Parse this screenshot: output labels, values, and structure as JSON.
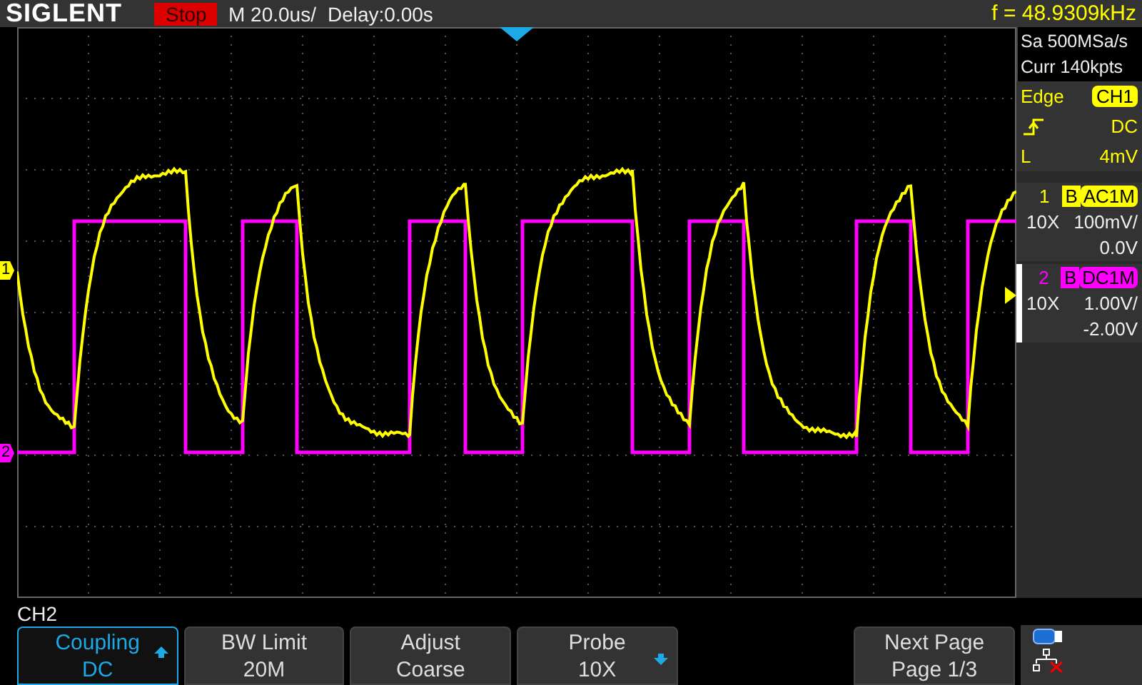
{
  "top_bar": {
    "logo": "SIGLENT",
    "run_state": "Stop",
    "timebase": "M 20.0us/",
    "delay": "Delay:0.00s",
    "frequency": "f = 48.9309kHz"
  },
  "acquisition": {
    "sample_rate": "Sa 500MSa/s",
    "memory": "Curr 140kpts"
  },
  "trigger": {
    "type": "Edge",
    "source": "CH1",
    "coupling": "DC",
    "mode": "L",
    "level": "4mV"
  },
  "channels": [
    {
      "marker": "1",
      "number": "1",
      "bandwidth": "B",
      "coupling": "AC1M",
      "probe": "10X",
      "scale": "100mV/",
      "offset": "0.0V",
      "color": "#ffff00",
      "selected": false
    },
    {
      "marker": "2",
      "number": "2",
      "bandwidth": "B",
      "coupling": "DC1M",
      "probe": "10X",
      "scale": "1.00V/",
      "offset": "-2.00V",
      "color": "#ff00ff",
      "selected": true
    }
  ],
  "menu_title": "CH2",
  "softkeys": [
    {
      "label": "Coupling",
      "value": "DC",
      "selected": true,
      "kind": "up"
    },
    {
      "label": "BW Limit",
      "value": "20M",
      "selected": false,
      "kind": "plain"
    },
    {
      "label": "Adjust",
      "value": "Coarse",
      "selected": false,
      "kind": "plain"
    },
    {
      "label": "Probe",
      "value": "10X",
      "selected": false,
      "kind": "down"
    },
    {
      "label": "Next Page",
      "value": "Page 1/3",
      "selected": false,
      "kind": "plain"
    }
  ]
}
